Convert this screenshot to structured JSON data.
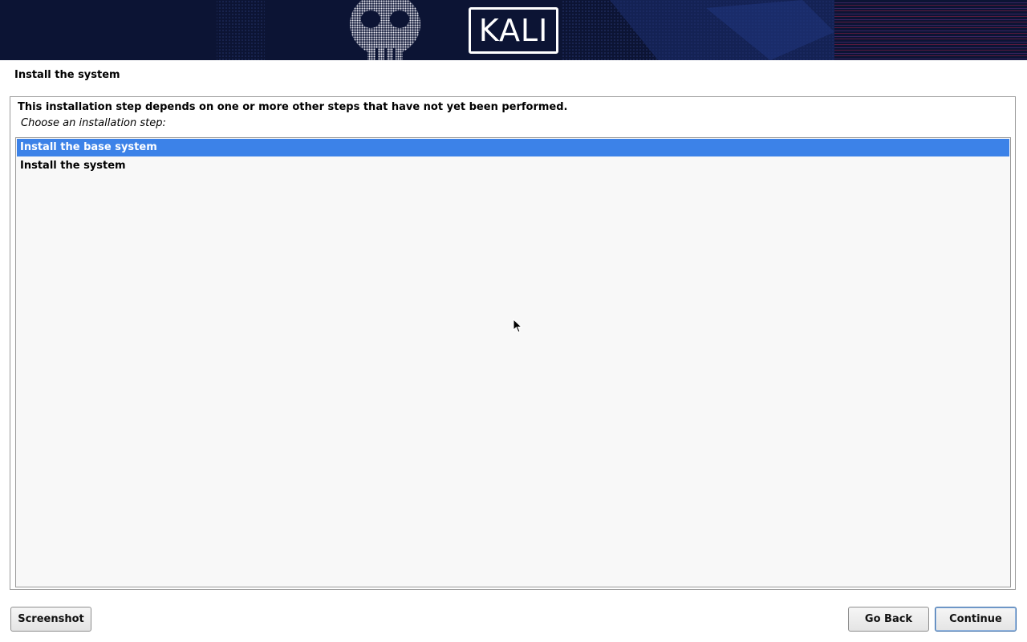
{
  "banner": {
    "logo_text": "KALI"
  },
  "page": {
    "title": "Install the system"
  },
  "panel": {
    "notice": "This installation step depends on one or more other steps that have not yet been performed.",
    "prompt": "Choose an installation step:",
    "steps": [
      {
        "label": "Install the base system",
        "selected": true
      },
      {
        "label": "Install the system",
        "selected": false
      }
    ]
  },
  "buttons": {
    "screenshot": "Screenshot",
    "go_back": "Go Back",
    "continue": "Continue"
  },
  "colors": {
    "banner_bg": "#0c1434",
    "selection": "#3c82e8"
  }
}
